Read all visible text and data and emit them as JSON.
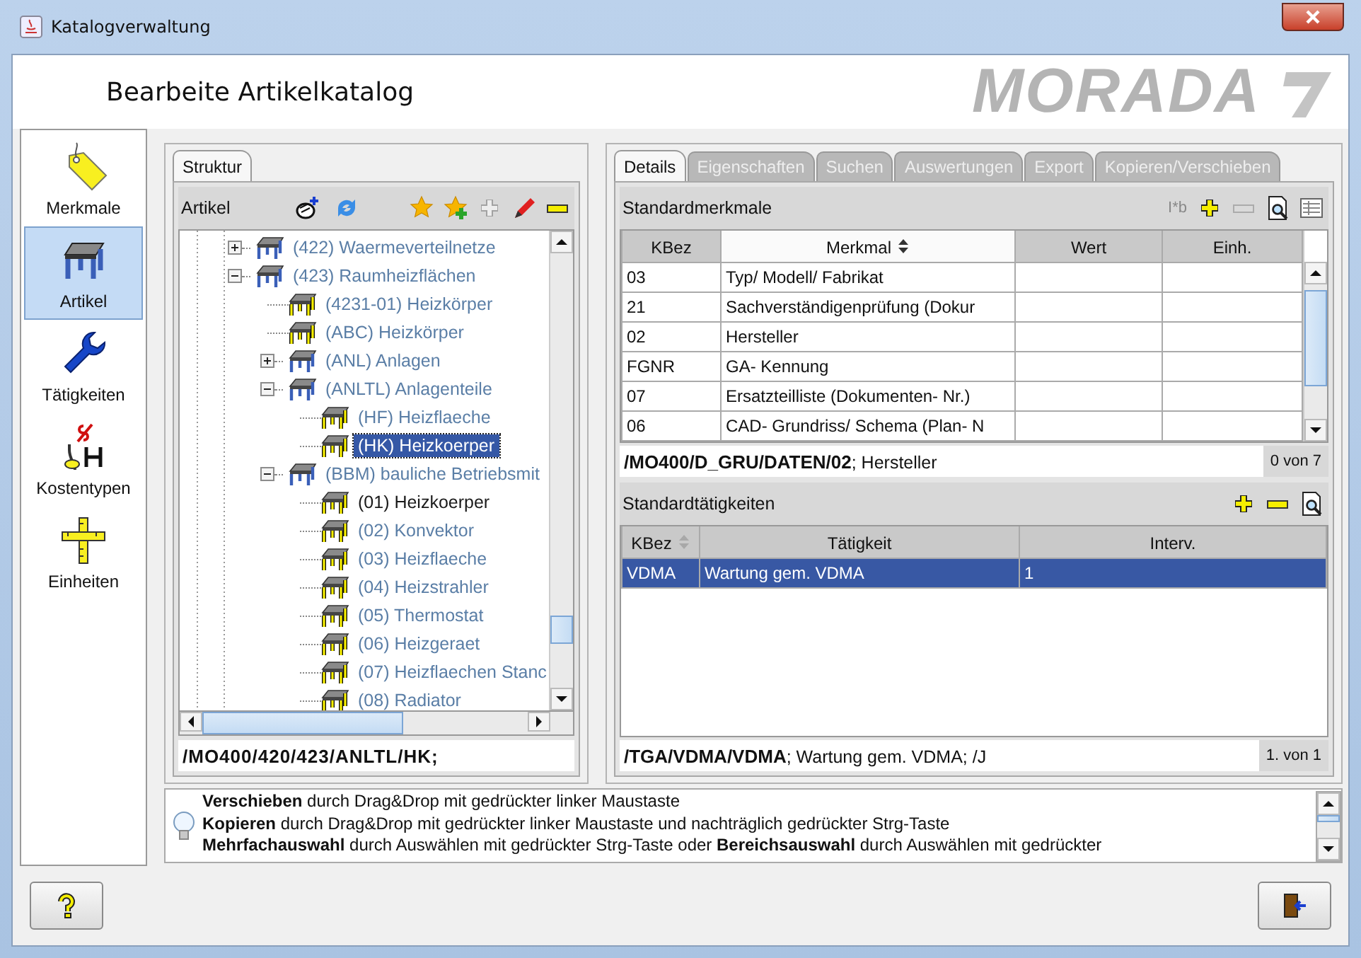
{
  "window": {
    "title": "Katalogverwaltung"
  },
  "header": {
    "title": "Bearbeite Artikelkatalog",
    "logo": "MORADA"
  },
  "nav": [
    {
      "label": "Merkmale",
      "kind": "tag",
      "selected": false
    },
    {
      "label": "Artikel",
      "kind": "article",
      "selected": true
    },
    {
      "label": "Tätigkeiten",
      "kind": "wrench",
      "selected": false
    },
    {
      "label": "Kostentypen",
      "kind": "cost",
      "selected": false
    },
    {
      "label": "Einheiten",
      "kind": "ruler",
      "selected": false
    }
  ],
  "structure": {
    "tabs": [
      {
        "label": "Struktur",
        "selected": true
      }
    ],
    "toolbar_label": "Artikel",
    "toolbar": [
      {
        "kind": "new",
        "disabled": false
      },
      {
        "kind": "refresh",
        "disabled": false
      },
      {
        "kind": "star",
        "disabled": false
      },
      {
        "kind": "star-add",
        "disabled": false
      },
      {
        "kind": "add",
        "disabled": true
      },
      {
        "kind": "edit",
        "disabled": false
      },
      {
        "kind": "remove",
        "disabled": false
      }
    ],
    "tree": [
      {
        "label": "(422) Waermeverteilnetze",
        "kind": "group",
        "expanded": false,
        "selected": false,
        "dimmed": true
      },
      {
        "label": "(423) Raumheizflächen",
        "kind": "group",
        "expanded": true,
        "selected": false,
        "dimmed": true,
        "children": [
          {
            "label": "(4231-01) Heizkörper",
            "kind": "article",
            "selected": false,
            "dimmed": true
          },
          {
            "label": "(ABC) Heizkörper",
            "kind": "article",
            "selected": false,
            "dimmed": true
          },
          {
            "label": "(ANL) Anlagen",
            "kind": "group",
            "expanded": false,
            "selected": false,
            "dimmed": true
          },
          {
            "label": "(ANLTL) Anlagenteile",
            "kind": "group",
            "expanded": true,
            "selected": false,
            "dimmed": true,
            "children": [
              {
                "label": "(HF) Heizflaeche",
                "kind": "article",
                "selected": false,
                "dimmed": true
              },
              {
                "label": "(HK) Heizkoerper",
                "kind": "article",
                "selected": true,
                "dimmed": true
              }
            ]
          },
          {
            "label": "(BBM) bauliche Betriebsmit",
            "kind": "group",
            "expanded": true,
            "selected": false,
            "dimmed": true,
            "children": [
              {
                "label": "(01) Heizkoerper",
                "kind": "article",
                "selected": false,
                "dimmed": false
              },
              {
                "label": "(02) Konvektor",
                "kind": "article",
                "selected": false,
                "dimmed": true
              },
              {
                "label": "(03) Heizflaeche",
                "kind": "article",
                "selected": false,
                "dimmed": true
              },
              {
                "label": "(04) Heizstrahler",
                "kind": "article",
                "selected": false,
                "dimmed": true
              },
              {
                "label": "(05) Thermostat",
                "kind": "article",
                "selected": false,
                "dimmed": true
              },
              {
                "label": "(06) Heizgeraet",
                "kind": "article",
                "selected": false,
                "dimmed": true
              },
              {
                "label": "(07) Heizflaechen Stanc",
                "kind": "article",
                "selected": false,
                "dimmed": true
              },
              {
                "label": "(08) Radiator",
                "kind": "article",
                "selected": false,
                "dimmed": true
              }
            ]
          }
        ]
      }
    ],
    "path": "/MO400/420/423/ANLTL/HK;"
  },
  "details": {
    "tabs": [
      {
        "label": "Details",
        "selected": true
      },
      {
        "label": "Eigenschaften",
        "selected": false
      },
      {
        "label": "Suchen",
        "selected": false
      },
      {
        "label": "Auswertungen",
        "selected": false
      },
      {
        "label": "Export",
        "selected": false
      },
      {
        "label": "Kopieren/Verschieben",
        "selected": false
      }
    ],
    "features": {
      "title": "Standardmerkmale",
      "toolbar_label": "I*b",
      "toolbar": [
        {
          "kind": "add",
          "disabled": false
        },
        {
          "kind": "remove",
          "disabled": true
        },
        {
          "kind": "preview",
          "disabled": false
        },
        {
          "kind": "table",
          "disabled": false
        }
      ],
      "columns": [
        {
          "label": "KBez",
          "sortable": false,
          "sorted": false
        },
        {
          "label": "Merkmal",
          "sortable": true,
          "sorted": true
        },
        {
          "label": "Wert",
          "sortable": false,
          "sorted": false
        },
        {
          "label": "Einh.",
          "sortable": false,
          "sorted": false
        }
      ],
      "rows": [
        {
          "cells": [
            "03",
            "Typ/ Modell/ Fabrikat",
            "",
            ""
          ],
          "selected": false
        },
        {
          "cells": [
            "21",
            "Sachverständigenprüfung (Dokur",
            "",
            ""
          ],
          "selected": false
        },
        {
          "cells": [
            "02",
            "Hersteller",
            "",
            ""
          ],
          "selected": false
        },
        {
          "cells": [
            "FGNR",
            "GA- Kennung",
            "",
            ""
          ],
          "selected": false
        },
        {
          "cells": [
            "07",
            "Ersatzteilliste (Dokumenten- Nr.)",
            "",
            ""
          ],
          "selected": false
        },
        {
          "cells": [
            "06",
            "CAD- Grundriss/ Schema (Plan- N",
            "",
            ""
          ],
          "selected": false
        }
      ],
      "status": "**/MO400/D_GRU/DATEN/02**; Hersteller",
      "count": "0 von 7"
    },
    "activities": {
      "title": "Standardtätigkeiten",
      "toolbar": [
        {
          "kind": "add",
          "disabled": false
        },
        {
          "kind": "remove",
          "disabled": false
        },
        {
          "kind": "preview",
          "disabled": false
        }
      ],
      "columns": [
        {
          "label": "KBez",
          "sortable": true,
          "sorted": false
        },
        {
          "label": "Tätigkeit",
          "sortable": false,
          "sorted": false
        },
        {
          "label": "Interv.",
          "sortable": false,
          "sorted": false
        }
      ],
      "rows": [
        {
          "cells": [
            "VDMA",
            "Wartung gem. VDMA",
            "1"
          ],
          "selected": true
        }
      ],
      "status": "**/TGA/VDMA/VDMA**; Wartung gem. VDMA; /J",
      "count": "1. von 1"
    }
  },
  "hints": [
    "**Verschieben** durch Drag&Drop mit gedrückter linker Maustaste",
    "**Kopieren** durch Drag&Drop mit gedrückter linker Maustaste und nachträglich gedrückter Strg-Taste",
    "**Mehrfachauswahl** durch Auswählen mit gedrückter Strg-Taste oder **Bereichsauswahl** durch Auswählen mit gedrückter"
  ]
}
